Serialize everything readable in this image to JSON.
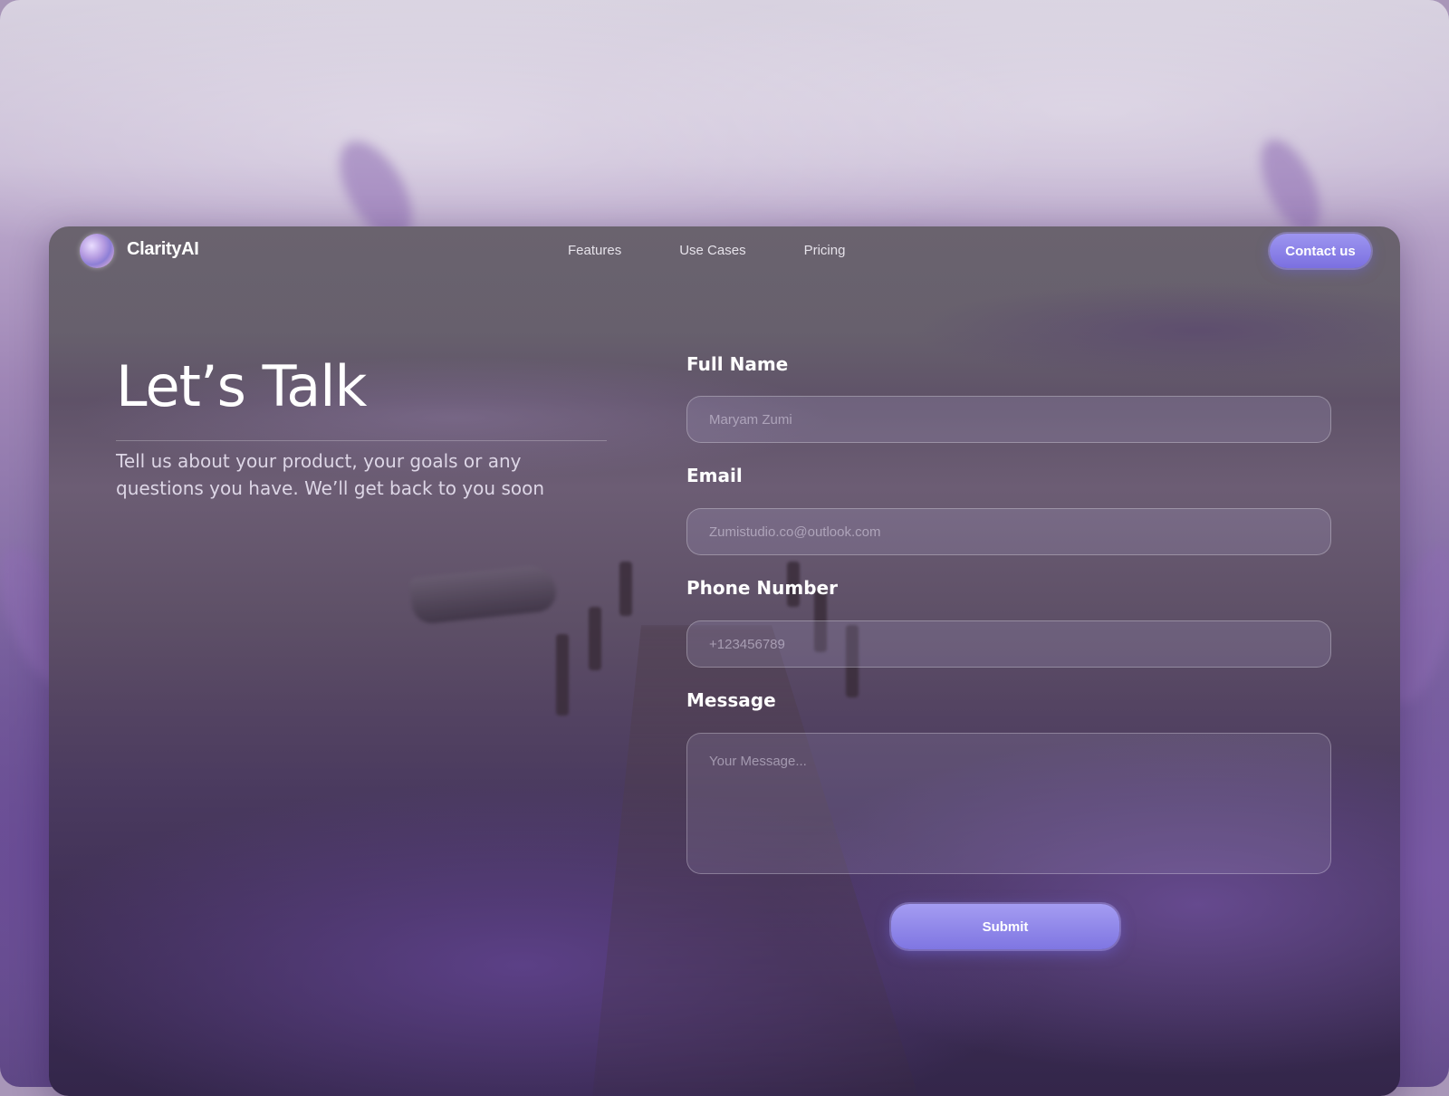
{
  "brand": {
    "name": "ClarityAI"
  },
  "nav": {
    "links": [
      "Features",
      "Use Cases",
      "Pricing"
    ],
    "contact_label": "Contact us"
  },
  "hero": {
    "title": "Let’s Talk",
    "subtitle": "Tell us about your product, your goals or any questions you have. We’ll get back to you soon"
  },
  "form": {
    "full_name": {
      "label": "Full Name",
      "placeholder": "Maryam Zumi"
    },
    "email": {
      "label": "Email",
      "placeholder": "Zumistudio.co@outlook.com"
    },
    "phone": {
      "label": "Phone Number",
      "placeholder": "+123456789"
    },
    "message": {
      "label": "Message",
      "placeholder": "Your Message..."
    },
    "submit_label": "Submit"
  },
  "colors": {
    "accent": "#8a82ea",
    "card_overlay": "#5f5268",
    "lavender": "#6c4e9a"
  }
}
